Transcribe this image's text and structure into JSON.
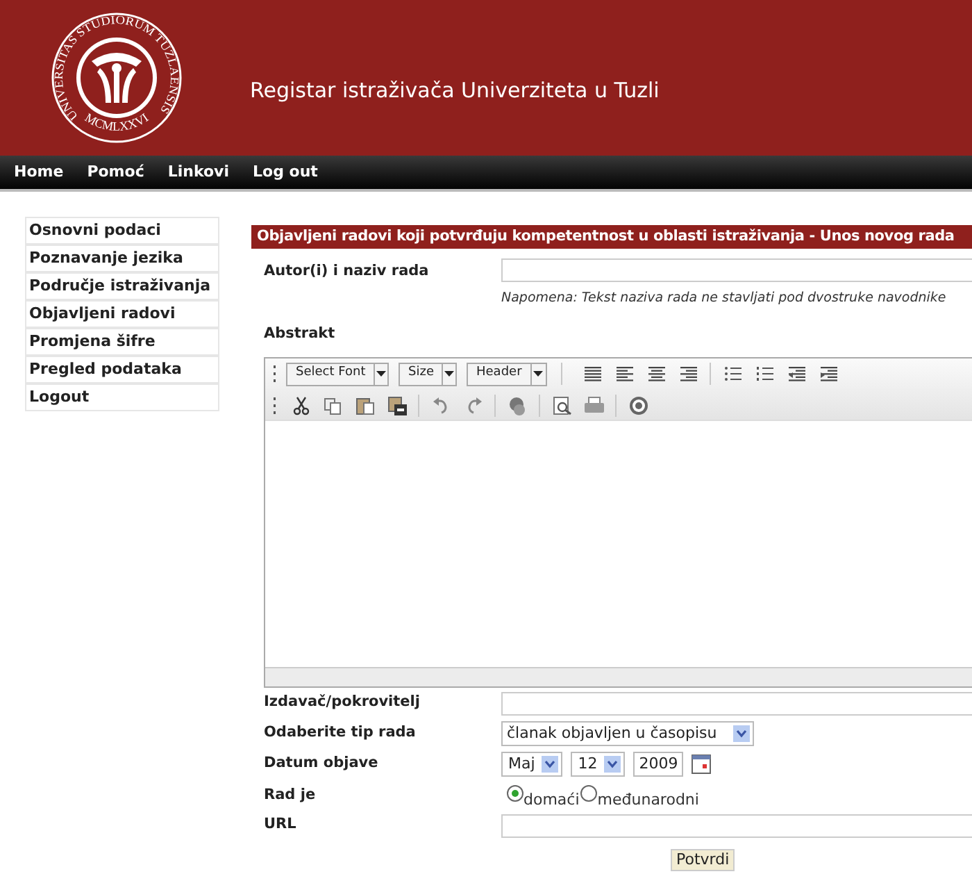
{
  "header": {
    "logo_top": "UNIVERSITAS STUDIORUM TUZLAENSIS",
    "logo_bottom": "MCMLXXVI",
    "title": "Registar istraživača Univerziteta u Tuzli"
  },
  "nav": [
    {
      "label": "Home"
    },
    {
      "label": "Pomoć"
    },
    {
      "label": "Linkovi"
    },
    {
      "label": "Log out"
    }
  ],
  "sidebar": {
    "items": [
      {
        "label": "Osnovni podaci"
      },
      {
        "label": "Poznavanje jezika"
      },
      {
        "label": "Područje istraživanja"
      },
      {
        "label": "Objavljeni radovi"
      },
      {
        "label": "Promjena šifre"
      },
      {
        "label": "Pregled podataka"
      },
      {
        "label": "Logout"
      }
    ]
  },
  "form": {
    "title": "Objavljeni radovi koji potvrđuju kompetentnost u oblasti istraživanja - Unos novog rada",
    "fields": [
      {
        "kind": "text",
        "label": "Autor(i) i naziv rada",
        "note": "Napomena: Tekst naziva rada ne stavljati pod dvostruke navodnike"
      },
      {
        "kind": "editor",
        "label": "Abstrakt",
        "dropdowns": [
          "Select Font",
          "Size",
          "Header"
        ]
      },
      {
        "kind": "text",
        "label": "Izdavač/pokrovitelj"
      },
      {
        "kind": "select",
        "label": "Odaberite tip rada",
        "value": "članak objavljen u časopisu"
      },
      {
        "kind": "date",
        "label": "Datum objave",
        "month": "Maj",
        "day": "12",
        "year": "2009"
      },
      {
        "kind": "radio",
        "label": "Rad je",
        "options": [
          {
            "label": "domaći",
            "selected": true
          },
          {
            "label": "međunarodni",
            "selected": false
          }
        ]
      },
      {
        "kind": "text",
        "label": "URL"
      }
    ],
    "submit": "Potvrdi"
  }
}
